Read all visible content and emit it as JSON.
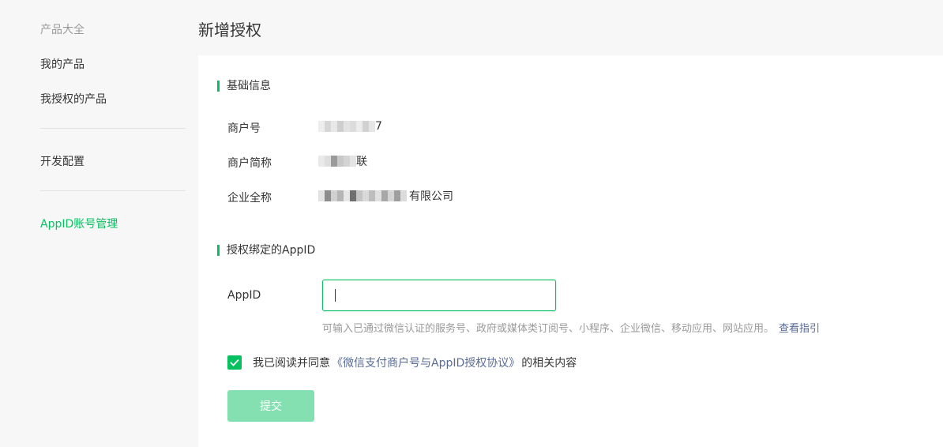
{
  "sidebar": {
    "heading": "产品大全",
    "items": [
      {
        "label": "我的产品"
      },
      {
        "label": "我授权的产品"
      },
      {
        "label": "开发配置"
      },
      {
        "label": "AppID账号管理"
      }
    ]
  },
  "page": {
    "title": "新增授权"
  },
  "basic_info": {
    "title": "基础信息",
    "rows": [
      {
        "label": "商户号",
        "value_suffix": "7"
      },
      {
        "label": "商户简称",
        "value_suffix": "联"
      },
      {
        "label": "企业全称",
        "value_suffix": "有限公司"
      }
    ]
  },
  "bind": {
    "title": "授权绑定的AppID",
    "appid_label": "AppID",
    "appid_value": "",
    "hint": "可输入已通过微信认证的服务号、政府或媒体类订阅号、小程序、企业微信、移动应用、网站应用。",
    "hint_link": "查看指引"
  },
  "agreement": {
    "checked": true,
    "prefix": "我已阅读并同意",
    "link": "《微信支付商户号与AppID授权协议》",
    "suffix": "的相关内容"
  },
  "submit_label": "提交",
  "colors": {
    "accent": "#07c160",
    "link": "#576b95",
    "disabled_button": "#84e0b0"
  }
}
